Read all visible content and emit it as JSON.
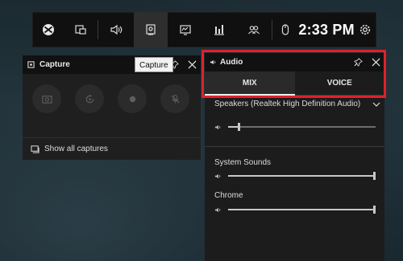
{
  "topbar": {
    "items": [
      "xbox-icon",
      "widget-menu-icon",
      "audio-icon",
      "capture-icon",
      "performance-icon",
      "resources-icon",
      "social-icon"
    ],
    "time": "2:33 PM"
  },
  "capture": {
    "title": "Capture",
    "tooltip": "Capture",
    "footer": "Show all captures"
  },
  "audio": {
    "title": "Audio",
    "tabs": [
      "MIX",
      "VOICE"
    ],
    "active_tab": "MIX",
    "device": "Speakers (Realtek High Definition Audio)",
    "device_volume": 0.08,
    "apps": [
      {
        "name": "System Sounds",
        "volume": 1.0
      },
      {
        "name": "Chrome",
        "volume": 1.0
      }
    ]
  },
  "colors": {
    "highlight": "#e0202a",
    "bar_bg": "#101010"
  }
}
